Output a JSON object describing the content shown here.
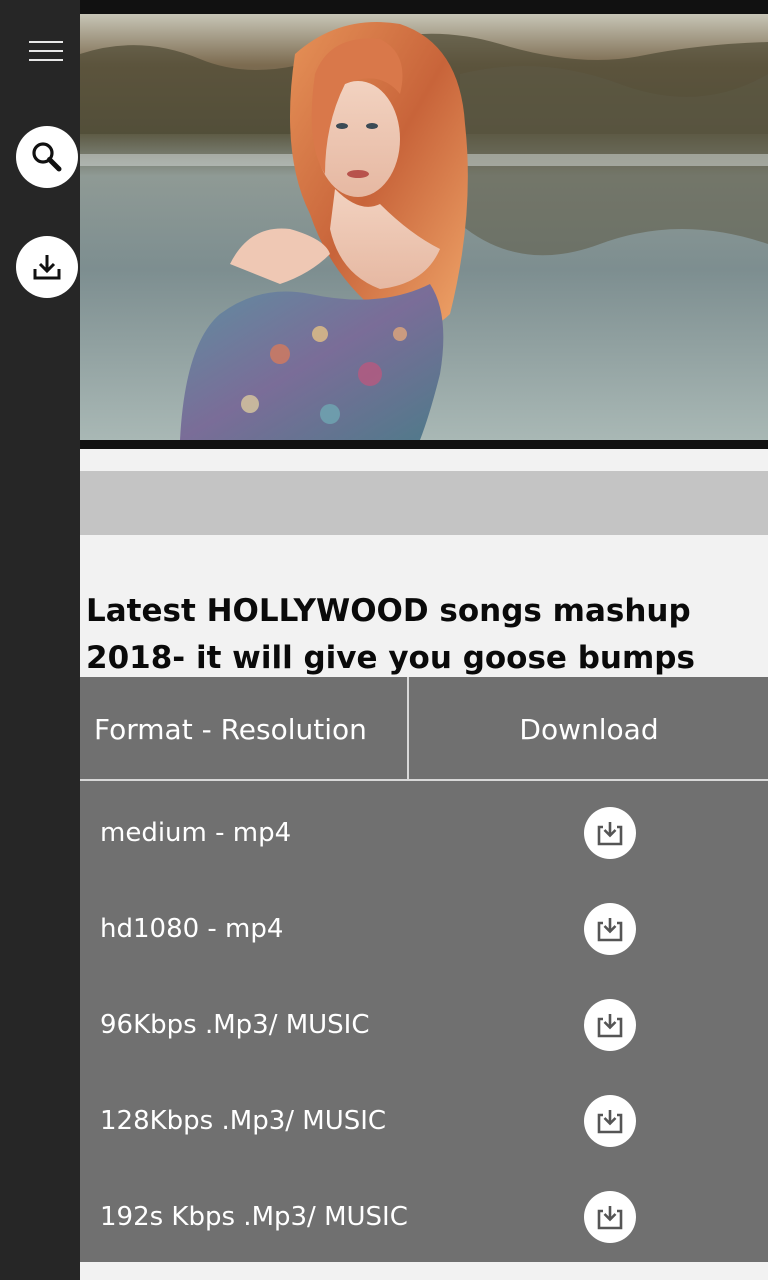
{
  "rail": {
    "menu_icon": "hamburger-menu-icon",
    "search_icon": "search-icon",
    "downloads_icon": "download-icon"
  },
  "video": {
    "thumbnail_icon": "video-thumbnail"
  },
  "title": "Latest HOLLYWOOD songs mashup 2018- it will give you goose bumps",
  "table": {
    "headers": {
      "format": "Format - Resolution",
      "download": "Download"
    },
    "rows": [
      {
        "format": "medium - mp4",
        "icon": "download-icon"
      },
      {
        "format": "hd1080 - mp4",
        "icon": "download-icon"
      },
      {
        "format": "96Kbps .Mp3/ MUSIC",
        "icon": "download-icon"
      },
      {
        "format": "128Kbps .Mp3/ MUSIC",
        "icon": "download-icon"
      },
      {
        "format": "192s Kbps .Mp3/ MUSIC",
        "icon": "download-icon"
      }
    ]
  },
  "colors": {
    "rail": "#262626",
    "table": "#707070",
    "band": "#c4c4c4"
  }
}
